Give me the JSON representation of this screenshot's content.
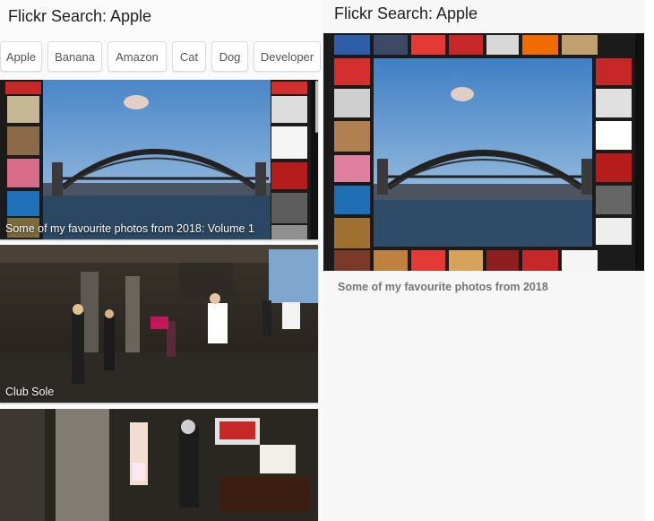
{
  "left": {
    "title": "Flickr Search: Apple",
    "chips": [
      "Apple",
      "Banana",
      "Amazon",
      "Cat",
      "Dog",
      "Developer"
    ],
    "photos": [
      {
        "caption": "Some of my favourite photos from 2018: Volume 1"
      },
      {
        "caption": "Club Sole"
      },
      {
        "caption": ""
      }
    ]
  },
  "detail": {
    "title": "Flickr Search: Apple",
    "caption": "Some of my favourite photos from 2018"
  }
}
